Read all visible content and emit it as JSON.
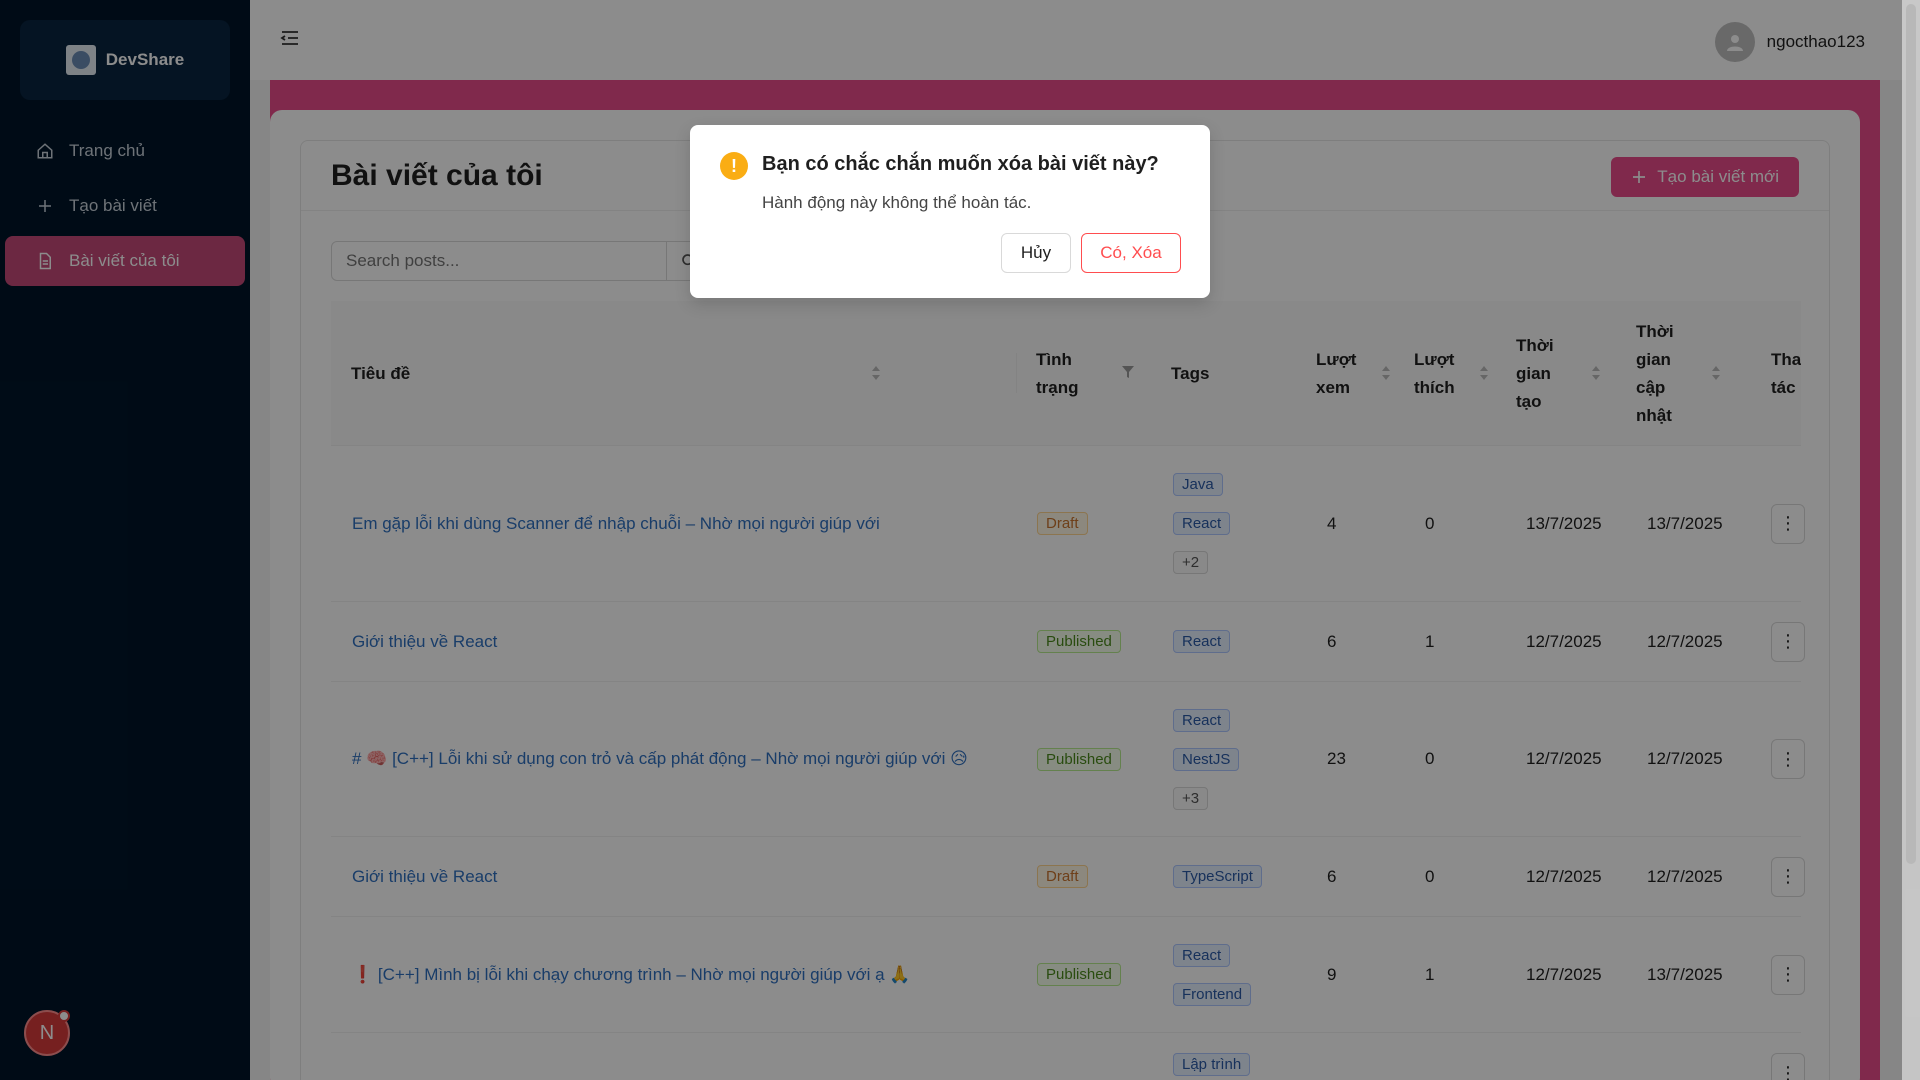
{
  "brand": {
    "name": "DevShare"
  },
  "sidebar": {
    "items": [
      {
        "label": "Trang chủ",
        "icon": "home-icon"
      },
      {
        "label": "Tạo bài viết",
        "icon": "plus-icon"
      },
      {
        "label": "Bài viết của tôi",
        "icon": "file-icon",
        "active": true
      }
    ],
    "fab_initial": "N"
  },
  "header": {
    "username": "ngocthao123"
  },
  "page": {
    "title": "Bài viết của tôi",
    "new_post_label": "Tạo bài viết mới",
    "search_placeholder": "Search posts..."
  },
  "table": {
    "columns": {
      "title": "Tiêu đề",
      "status": "Tình trạng",
      "tags": "Tags",
      "views": "Lượt xem",
      "likes": "Lượt thích",
      "created": "Thời gian tạo",
      "updated": "Thời gian cập nhật",
      "actions": "Thao tác"
    },
    "rows": [
      {
        "title": "Em gặp lỗi khi dùng Scanner để nhập chuỗi – Nhờ mọi người giúp với",
        "status": "Draft",
        "tags": [
          "Java",
          "React",
          "+2"
        ],
        "views": "4",
        "likes": "0",
        "created": "13/7/2025",
        "updated": "13/7/2025"
      },
      {
        "title": "Giới thiệu về React",
        "status": "Published",
        "tags": [
          "React"
        ],
        "views": "6",
        "likes": "1",
        "created": "12/7/2025",
        "updated": "12/7/2025"
      },
      {
        "title": "# 🧠 [C++] Lỗi khi sử dụng con trỏ và cấp phát động – Nhờ mọi người giúp với 😥",
        "status": "Published",
        "tags": [
          "React",
          "NestJS",
          "+3"
        ],
        "views": "23",
        "likes": "0",
        "created": "12/7/2025",
        "updated": "12/7/2025"
      },
      {
        "title": "Giới thiệu về React",
        "status": "Draft",
        "tags": [
          "TypeScript"
        ],
        "views": "6",
        "likes": "0",
        "created": "12/7/2025",
        "updated": "12/7/2025"
      },
      {
        "title": "❗ [C++] Mình bị lỗi khi chạy chương trình – Nhờ mọi người giúp với ạ 🙏",
        "status": "Published",
        "tags": [
          "React",
          "Frontend"
        ],
        "views": "9",
        "likes": "1",
        "created": "12/7/2025",
        "updated": "13/7/2025"
      },
      {
        "title": "",
        "status": "",
        "tags": [
          "Lập trình"
        ],
        "views": "",
        "likes": "",
        "created": "",
        "updated": ""
      }
    ]
  },
  "modal": {
    "title": "Bạn có chắc chắn muốn xóa bài viết này?",
    "description": "Hành động này không thể hoàn tác.",
    "cancel_label": "Hủy",
    "confirm_label": "Có, Xóa"
  },
  "colors": {
    "sidebar": "#001529",
    "accent": "#e94c8b",
    "danger": "#ff4d4f",
    "warning": "#faad14"
  }
}
